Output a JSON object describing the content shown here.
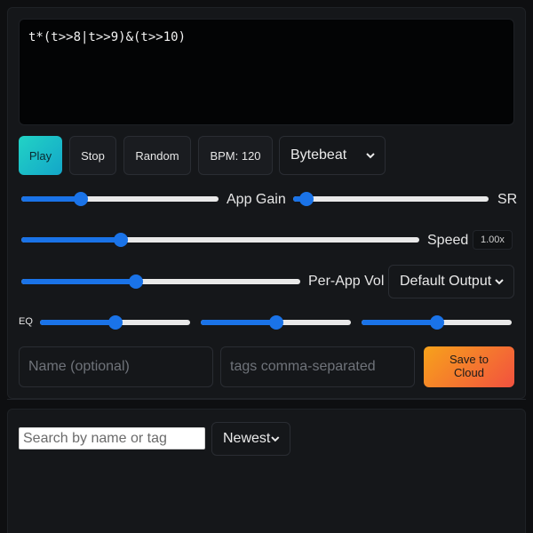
{
  "editor": {
    "code": "t*(t>>8|t>>9)&(t>>10)"
  },
  "toolbar": {
    "play_label": "Play",
    "stop_label": "Stop",
    "random_label": "Random",
    "bpm_label": "BPM: 120",
    "mode_select": {
      "selected": "Bytebeat"
    }
  },
  "controls": {
    "app_gain": {
      "label": "App Gain",
      "value": 0.3
    },
    "sr": {
      "label": "SR",
      "value": 0.07
    },
    "speed": {
      "label": "Speed",
      "value": 0.25,
      "readout": "1.00x"
    },
    "per_app_vol": {
      "label": "Per-App Vol",
      "value": 0.41
    },
    "output_select": {
      "selected": "Default Output"
    },
    "eq": {
      "label": "EQ",
      "bands": [
        0.5,
        0.5,
        0.5
      ]
    }
  },
  "save_form": {
    "name_placeholder": "Name (optional)",
    "tags_placeholder": "tags comma-separated",
    "save_label": "Save to Cloud"
  },
  "library": {
    "search_placeholder": "Search by name or tag",
    "sort_select": {
      "selected": "Newest"
    }
  },
  "colors": {
    "accent_blue": "#1a73e8",
    "play_gradient": [
      "#22d3c5",
      "#13a6c9"
    ],
    "save_gradient": [
      "#f7a21b",
      "#f2513f"
    ],
    "background": "#0e0f11"
  }
}
